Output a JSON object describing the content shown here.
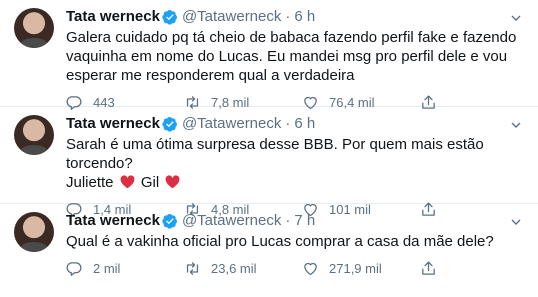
{
  "tweets": [
    {
      "name": "Tata werneck",
      "handle": "@Tatawerneck",
      "separator": "·",
      "time": "6 h",
      "text": "Galera cuidado pq tá cheio de babaca fazendo perfil fake e fazendo vaquinha em nome do Lucas. Eu mandei msg pro perfil dele e vou esperar me responderem qual a verdadeira",
      "replies": "443",
      "retweets": "7,8 mil",
      "likes": "76,4 mil"
    },
    {
      "name": "Tata werneck",
      "handle": "@Tatawerneck",
      "separator": "·",
      "time": "6 h",
      "text_line1": "Sarah é uma ótima surpresa desse BBB. Por quem mais estão torcendo?",
      "text_line2_a": "Juliette",
      "text_line2_b": "Gil",
      "replies": "1,4 mil",
      "retweets": "4,8 mil",
      "likes": "101 mil"
    },
    {
      "name": "Tata werneck",
      "handle": "@Tatawerneck",
      "separator": "·",
      "time": "7 h",
      "text": "Qual é a vakinha oficial pro Lucas comprar a casa da mãe dele?",
      "replies": "2 mil",
      "retweets": "23,6 mil",
      "likes": "271,9 mil"
    }
  ],
  "icons": {
    "verified": "verified-badge-icon",
    "more": "chevron-down-icon",
    "reply": "reply-icon",
    "retweet": "retweet-icon",
    "like": "heart-icon",
    "share": "share-icon",
    "emoji": "red-heart-emoji"
  },
  "colors": {
    "verified": "#1da1f2",
    "secondary_text": "#5b7083",
    "emoji_heart": "#dd2e44",
    "divider": "#e6ecf0"
  }
}
